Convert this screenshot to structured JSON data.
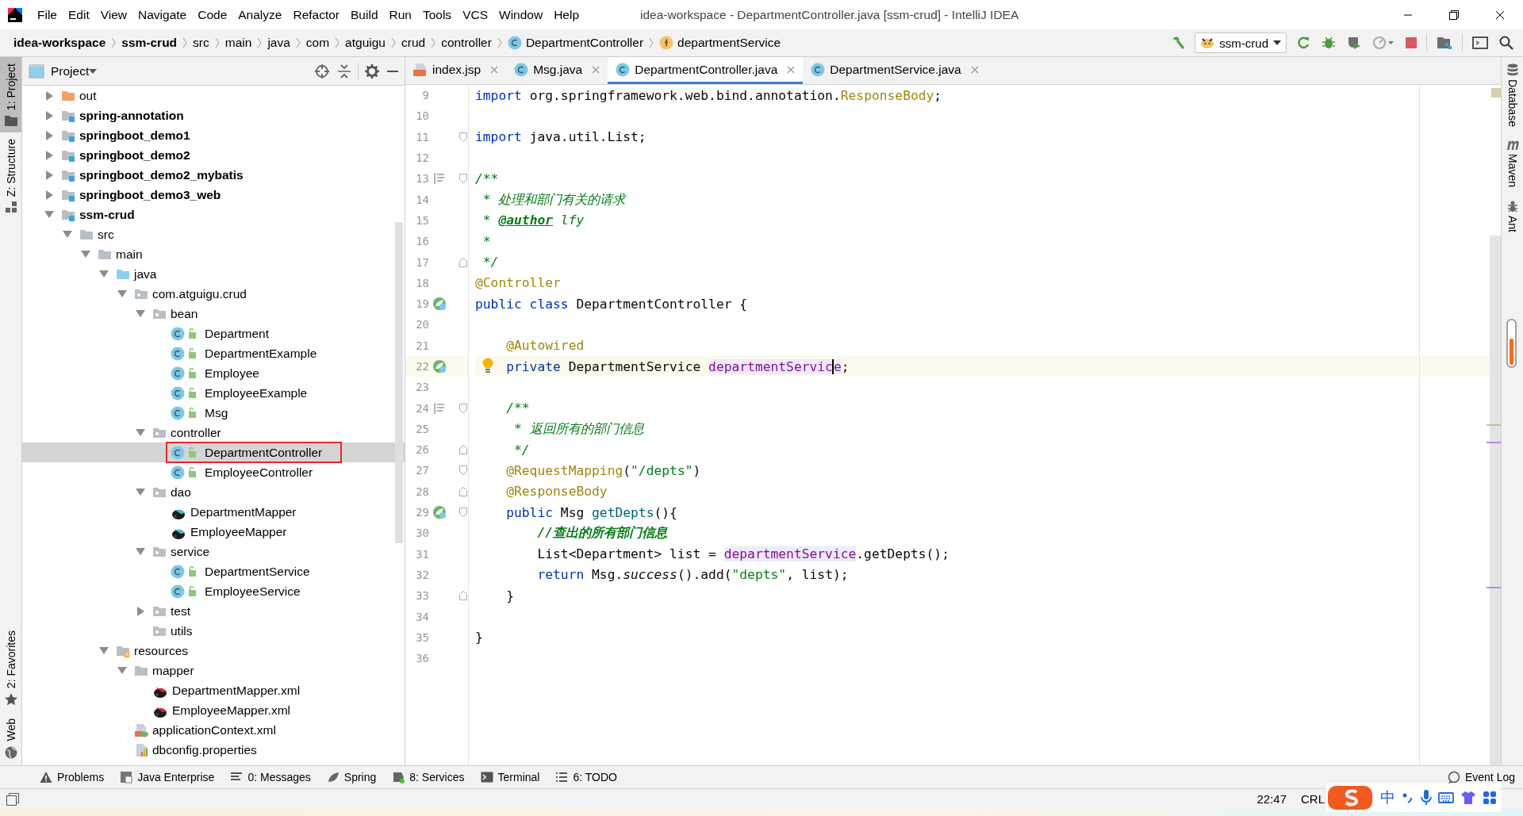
{
  "window": {
    "title": "idea-workspace - DepartmentController.java [ssm-crud] - IntelliJ IDEA"
  },
  "menu": [
    "File",
    "Edit",
    "View",
    "Navigate",
    "Code",
    "Analyze",
    "Refactor",
    "Build",
    "Run",
    "Tools",
    "VCS",
    "Window",
    "Help"
  ],
  "breadcrumbs": [
    {
      "label": "idea-workspace",
      "kind": "module"
    },
    {
      "label": "ssm-crud",
      "kind": "module"
    },
    {
      "label": "src",
      "kind": "folder"
    },
    {
      "label": "main",
      "kind": "folder"
    },
    {
      "label": "java",
      "kind": "folder"
    },
    {
      "label": "com",
      "kind": "folder"
    },
    {
      "label": "atguigu",
      "kind": "folder"
    },
    {
      "label": "crud",
      "kind": "folder"
    },
    {
      "label": "controller",
      "kind": "folder"
    },
    {
      "label": "DepartmentController",
      "kind": "class"
    },
    {
      "label": "departmentService",
      "kind": "field"
    }
  ],
  "run_configuration": "ssm-crud",
  "left_tool_tabs": [
    {
      "label": "1: Project",
      "selected": true,
      "kind": "project"
    },
    {
      "label": "Z: Structure",
      "selected": false,
      "kind": "structure"
    }
  ],
  "left_bottom_tabs": [
    {
      "label": "2: Favorites",
      "kind": "favorites"
    },
    {
      "label": "Web",
      "kind": "web"
    }
  ],
  "project_panel": {
    "title": "Project",
    "selection_outline": true,
    "tree": [
      {
        "label": "out",
        "kind": "excluded",
        "expanded": false,
        "selected": false
      },
      {
        "label": "spring-annotation",
        "kind": "module",
        "expanded": false,
        "selected": false
      },
      {
        "label": "springboot_demo1",
        "kind": "module",
        "expanded": false,
        "selected": false
      },
      {
        "label": "springboot_demo2",
        "kind": "module",
        "expanded": false,
        "selected": false
      },
      {
        "label": "springboot_demo2_mybatis",
        "kind": "module",
        "expanded": false,
        "selected": false
      },
      {
        "label": "springboot_demo3_web",
        "kind": "module",
        "expanded": false,
        "selected": false
      },
      {
        "label": "ssm-crud",
        "kind": "module",
        "expanded": true,
        "selected": false,
        "children": [
          {
            "label": "src",
            "kind": "folder",
            "expanded": true,
            "selected": false,
            "children": [
              {
                "label": "main",
                "kind": "folder",
                "expanded": true,
                "selected": false,
                "children": [
                  {
                    "label": "java",
                    "kind": "source-root",
                    "expanded": true,
                    "selected": false,
                    "children": [
                      {
                        "label": "com.atguigu.crud",
                        "kind": "package",
                        "expanded": true,
                        "selected": false,
                        "children": [
                          {
                            "label": "bean",
                            "kind": "package",
                            "expanded": true,
                            "selected": false,
                            "children": [
                              {
                                "label": "Department",
                                "kind": "class",
                                "selected": false
                              },
                              {
                                "label": "DepartmentExample",
                                "kind": "class",
                                "selected": false
                              },
                              {
                                "label": "Employee",
                                "kind": "class",
                                "selected": false
                              },
                              {
                                "label": "EmployeeExample",
                                "kind": "class",
                                "selected": false
                              },
                              {
                                "label": "Msg",
                                "kind": "class",
                                "selected": false
                              }
                            ]
                          },
                          {
                            "label": "controller",
                            "kind": "package",
                            "expanded": true,
                            "selected": false,
                            "children": [
                              {
                                "label": "DepartmentController",
                                "kind": "class",
                                "selected": true
                              },
                              {
                                "label": "EmployeeController",
                                "kind": "class",
                                "selected": false
                              }
                            ]
                          },
                          {
                            "label": "dao",
                            "kind": "package",
                            "expanded": true,
                            "selected": false,
                            "children": [
                              {
                                "label": "DepartmentMapper",
                                "kind": "mapper",
                                "selected": false
                              },
                              {
                                "label": "EmployeeMapper",
                                "kind": "mapper",
                                "selected": false
                              }
                            ]
                          },
                          {
                            "label": "service",
                            "kind": "package",
                            "expanded": true,
                            "selected": false,
                            "children": [
                              {
                                "label": "DepartmentService",
                                "kind": "class",
                                "selected": false
                              },
                              {
                                "label": "EmployeeService",
                                "kind": "class",
                                "selected": false
                              }
                            ]
                          },
                          {
                            "label": "test",
                            "kind": "package",
                            "expanded": false,
                            "selected": false
                          },
                          {
                            "label": "utils",
                            "kind": "package",
                            "selected": false
                          }
                        ]
                      }
                    ]
                  },
                  {
                    "label": "resources",
                    "kind": "resources",
                    "expanded": true,
                    "selected": false,
                    "children": [
                      {
                        "label": "mapper",
                        "kind": "folder",
                        "expanded": true,
                        "selected": false,
                        "children": [
                          {
                            "label": "DepartmentMapper.xml",
                            "kind": "mapper-xml",
                            "selected": false
                          },
                          {
                            "label": "EmployeeMapper.xml",
                            "kind": "mapper-xml",
                            "selected": false
                          }
                        ]
                      },
                      {
                        "label": "applicationContext.xml",
                        "kind": "spring-xml",
                        "selected": false
                      },
                      {
                        "label": "dbconfig.properties",
                        "kind": "properties",
                        "selected": false
                      }
                    ]
                  }
                ]
              }
            ]
          }
        ]
      }
    ]
  },
  "editor_tabs": [
    {
      "label": "index.jsp",
      "kind": "jsp",
      "selected": false
    },
    {
      "label": "Msg.java",
      "kind": "class",
      "selected": false
    },
    {
      "label": "DepartmentController.java",
      "kind": "class",
      "selected": true
    },
    {
      "label": "DepartmentService.java",
      "kind": "class",
      "selected": false
    }
  ],
  "code_lines": [
    {
      "number": "9",
      "current": false,
      "tokens": [
        {
          "text": "import",
          "kind": "kw"
        },
        {
          "text": " org.springframework.web.bind.annotation.",
          "kind": "id"
        },
        {
          "text": "ResponseBody",
          "kind": "ann"
        },
        {
          "text": ";",
          "kind": "id"
        }
      ]
    },
    {
      "number": "10",
      "current": false
    },
    {
      "number": "11",
      "current": false,
      "gutter": [
        {
          "kind": "fold-start"
        }
      ],
      "tokens": [
        {
          "text": "import",
          "kind": "kw"
        },
        {
          "text": " java.util.List;",
          "kind": "id"
        }
      ]
    },
    {
      "number": "12",
      "current": false
    },
    {
      "number": "13",
      "current": false,
      "gutter": [
        {
          "kind": "doc"
        },
        {
          "kind": "fold-start"
        }
      ],
      "tokens": [
        {
          "text": "/**",
          "kind": "doc"
        }
      ]
    },
    {
      "number": "14",
      "current": false,
      "tokens": [
        {
          "text": " * 处理和部门有关的请求",
          "kind": "doc"
        }
      ]
    },
    {
      "number": "15",
      "current": false,
      "tokens": [
        {
          "text": " * ",
          "kind": "doc"
        },
        {
          "text": "@author",
          "kind": "doctag"
        },
        {
          "text": " lfy",
          "kind": "doc"
        }
      ]
    },
    {
      "number": "16",
      "current": false,
      "tokens": [
        {
          "text": " *",
          "kind": "doc"
        }
      ]
    },
    {
      "number": "17",
      "current": false,
      "gutter": [
        {
          "kind": "fold-end"
        }
      ],
      "tokens": [
        {
          "text": " */",
          "kind": "doc"
        }
      ]
    },
    {
      "number": "18",
      "current": false,
      "tokens": [
        {
          "text": "@Controller",
          "kind": "ann"
        }
      ]
    },
    {
      "number": "19",
      "current": false,
      "gutter": [
        {
          "kind": "spring"
        }
      ],
      "tokens": [
        {
          "text": "public class",
          "kind": "kw"
        },
        {
          "text": " DepartmentController {",
          "kind": "id"
        }
      ]
    },
    {
      "number": "20",
      "current": false
    },
    {
      "number": "21",
      "current": false,
      "tokens": [
        {
          "text": "    @Autowired",
          "kind": "ann"
        }
      ]
    },
    {
      "number": "22",
      "current": true,
      "gutter": [
        {
          "kind": "spring"
        }
      ],
      "tokens": [
        {
          "text": "    private",
          "kind": "kw"
        },
        {
          "text": " DepartmentService ",
          "kind": "id"
        },
        {
          "text": "departmentServic",
          "kind": "field-hl"
        },
        {
          "text": "e",
          "kind": "field-hl-caret"
        },
        {
          "text": ";",
          "kind": "id"
        }
      ]
    },
    {
      "number": "23",
      "current": false
    },
    {
      "number": "24",
      "current": false,
      "gutter": [
        {
          "kind": "doc"
        },
        {
          "kind": "fold-start"
        }
      ],
      "tokens": [
        {
          "text": "    /**",
          "kind": "doc"
        }
      ]
    },
    {
      "number": "25",
      "current": false,
      "tokens": [
        {
          "text": "     * 返回所有的部门信息",
          "kind": "doc"
        }
      ]
    },
    {
      "number": "26",
      "current": false,
      "gutter": [
        {
          "kind": "fold-end"
        }
      ],
      "tokens": [
        {
          "text": "     */",
          "kind": "doc"
        }
      ]
    },
    {
      "number": "27",
      "current": false,
      "gutter": [
        {
          "kind": "fold-start"
        }
      ],
      "tokens": [
        {
          "text": "    @RequestMapping",
          "kind": "ann"
        },
        {
          "text": "(",
          "kind": "id"
        },
        {
          "text": "\"/depts\"",
          "kind": "str"
        },
        {
          "text": ")",
          "kind": "id"
        }
      ]
    },
    {
      "number": "28",
      "current": false,
      "gutter": [
        {
          "kind": "fold-end"
        }
      ],
      "tokens": [
        {
          "text": "    @ResponseBody",
          "kind": "ann"
        }
      ]
    },
    {
      "number": "29",
      "current": false,
      "gutter": [
        {
          "kind": "spring"
        },
        {
          "kind": "fold-start"
        }
      ],
      "tokens": [
        {
          "text": "    public",
          "kind": "kw"
        },
        {
          "text": " Msg ",
          "kind": "id"
        },
        {
          "text": "getDepts",
          "kind": "fn"
        },
        {
          "text": "(){",
          "kind": "id"
        }
      ]
    },
    {
      "number": "30",
      "current": false,
      "tokens": [
        {
          "text": "        //查出的所有部门信息",
          "kind": "comment"
        }
      ]
    },
    {
      "number": "31",
      "current": false,
      "tokens": [
        {
          "text": "        List<Department> list = ",
          "kind": "id"
        },
        {
          "text": "departmentService",
          "kind": "field-hl"
        },
        {
          "text": ".getDepts();",
          "kind": "id"
        }
      ]
    },
    {
      "number": "32",
      "current": false,
      "tokens": [
        {
          "text": "        return",
          "kind": "kw"
        },
        {
          "text": " Msg.",
          "kind": "id"
        },
        {
          "text": "success",
          "kind": "static"
        },
        {
          "text": "().add(",
          "kind": "id"
        },
        {
          "text": "\"depts\"",
          "kind": "str"
        },
        {
          "text": ", list);",
          "kind": "id"
        }
      ]
    },
    {
      "number": "33",
      "current": false,
      "gutter": [
        {
          "kind": "fold-end"
        }
      ],
      "tokens": [
        {
          "text": "    }",
          "kind": "id"
        }
      ]
    },
    {
      "number": "34",
      "current": false
    },
    {
      "number": "35",
      "current": false,
      "tokens": [
        {
          "text": "}",
          "kind": "id"
        }
      ]
    },
    {
      "number": "36",
      "current": false
    }
  ],
  "right_tool_tabs": [
    {
      "label": "Database",
      "kind": "database"
    },
    {
      "label": "Maven",
      "kind": "maven"
    },
    {
      "label": "Ant",
      "kind": "ant"
    }
  ],
  "bottom_tool_tabs": [
    {
      "label": "Problems",
      "kind": "problems"
    },
    {
      "label": "Java Enterprise",
      "kind": "enterprise"
    },
    {
      "label": "0: Messages",
      "kind": "messages"
    },
    {
      "label": "Spring",
      "kind": "spring"
    },
    {
      "label": "8: Services",
      "kind": "services"
    },
    {
      "label": "Terminal",
      "kind": "terminal"
    },
    {
      "label": "6: TODO",
      "kind": "todo"
    }
  ],
  "event_log": "Event Log",
  "status_bar": {
    "time": "22:47",
    "line_separator": "CRL"
  },
  "ime_toolbar": {
    "mode": "中"
  }
}
